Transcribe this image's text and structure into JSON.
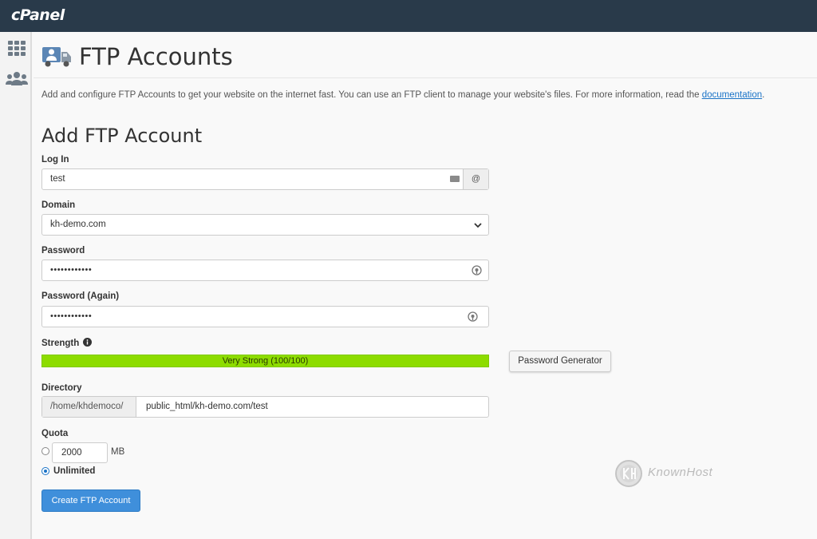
{
  "app": {
    "logo": "cPanel"
  },
  "page": {
    "title": "FTP Accounts",
    "description_prefix": "Add and configure FTP Accounts to get your website on the internet fast. You can use an FTP client to manage your website's files. For more information, read the",
    "description_link": "documentation",
    "description_suffix": "."
  },
  "form": {
    "section_title": "Add FTP Account",
    "login": {
      "label": "Log In",
      "value": "test",
      "addon": "@"
    },
    "domain": {
      "label": "Domain",
      "value": "kh-demo.com"
    },
    "password": {
      "label": "Password",
      "value": "••••••••••••"
    },
    "password_again": {
      "label": "Password (Again)",
      "value": "••••••••••••"
    },
    "strength": {
      "label": "Strength",
      "text": "Very Strong (100/100)",
      "score": 100,
      "color": "#8ddc00"
    },
    "password_generator_label": "Password Generator",
    "directory": {
      "label": "Directory",
      "prefix": "/home/khdemoco/",
      "value": "public_html/kh-demo.com/test"
    },
    "quota": {
      "label": "Quota",
      "value": "2000",
      "unit": "MB",
      "unlimited_label": "Unlimited",
      "selected": "unlimited"
    },
    "submit_label": "Create FTP Account"
  },
  "watermark": {
    "text": "KnownHost"
  },
  "icons": {
    "apps": "grid-icon",
    "users": "users-icon",
    "page": "ftp-truck-icon"
  },
  "colors": {
    "topbar": "#293a4a",
    "primary_button": "#3f8fdb",
    "link": "#1a73c7"
  }
}
